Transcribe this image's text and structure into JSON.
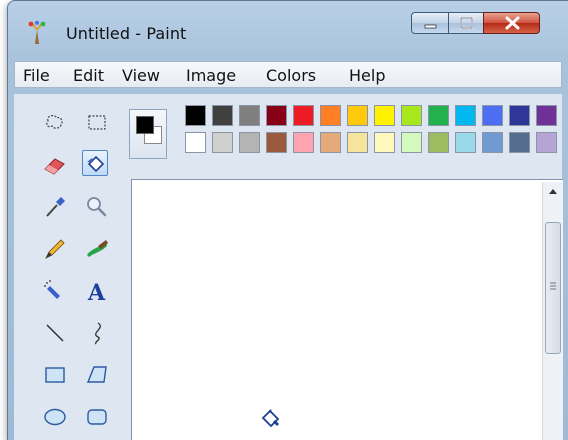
{
  "window": {
    "title": "Untitled - Paint"
  },
  "menu": [
    "File",
    "Edit",
    "View",
    "Image",
    "Colors",
    "Help"
  ],
  "tools": [
    {
      "name": "free-form-select-icon"
    },
    {
      "name": "rect-select-icon"
    },
    {
      "name": "eraser-icon"
    },
    {
      "name": "fill-bucket-icon",
      "selected": true
    },
    {
      "name": "color-picker-icon"
    },
    {
      "name": "magnifier-icon"
    },
    {
      "name": "pencil-icon"
    },
    {
      "name": "brush-icon"
    },
    {
      "name": "airbrush-icon"
    },
    {
      "name": "text-icon",
      "glyph": "A"
    },
    {
      "name": "line-icon"
    },
    {
      "name": "curve-icon"
    },
    {
      "name": "rectangle-icon"
    },
    {
      "name": "polygon-icon"
    },
    {
      "name": "ellipse-icon"
    },
    {
      "name": "rounded-rect-icon"
    }
  ],
  "colors": {
    "foreground": "#000000",
    "background": "#ffffff",
    "palette_row1": [
      "#000000",
      "#404040",
      "#7f7f7f",
      "#880015",
      "#ed1c24",
      "#ff7f27",
      "#ffc90e",
      "#fff200",
      "#a8e61d",
      "#22b14c",
      "#00b7ef",
      "#4d6df3",
      "#2f3699",
      "#6f3198"
    ],
    "palette_row2": [
      "#ffffff",
      "#d0d0d0",
      "#b4b4b4",
      "#9c5a3c",
      "#ffa3b1",
      "#e5aa7a",
      "#f5e49c",
      "#fff9bd",
      "#d3f9bc",
      "#9dbb61",
      "#99d9ea",
      "#709ad1",
      "#546d8e",
      "#b5a5d5"
    ]
  }
}
